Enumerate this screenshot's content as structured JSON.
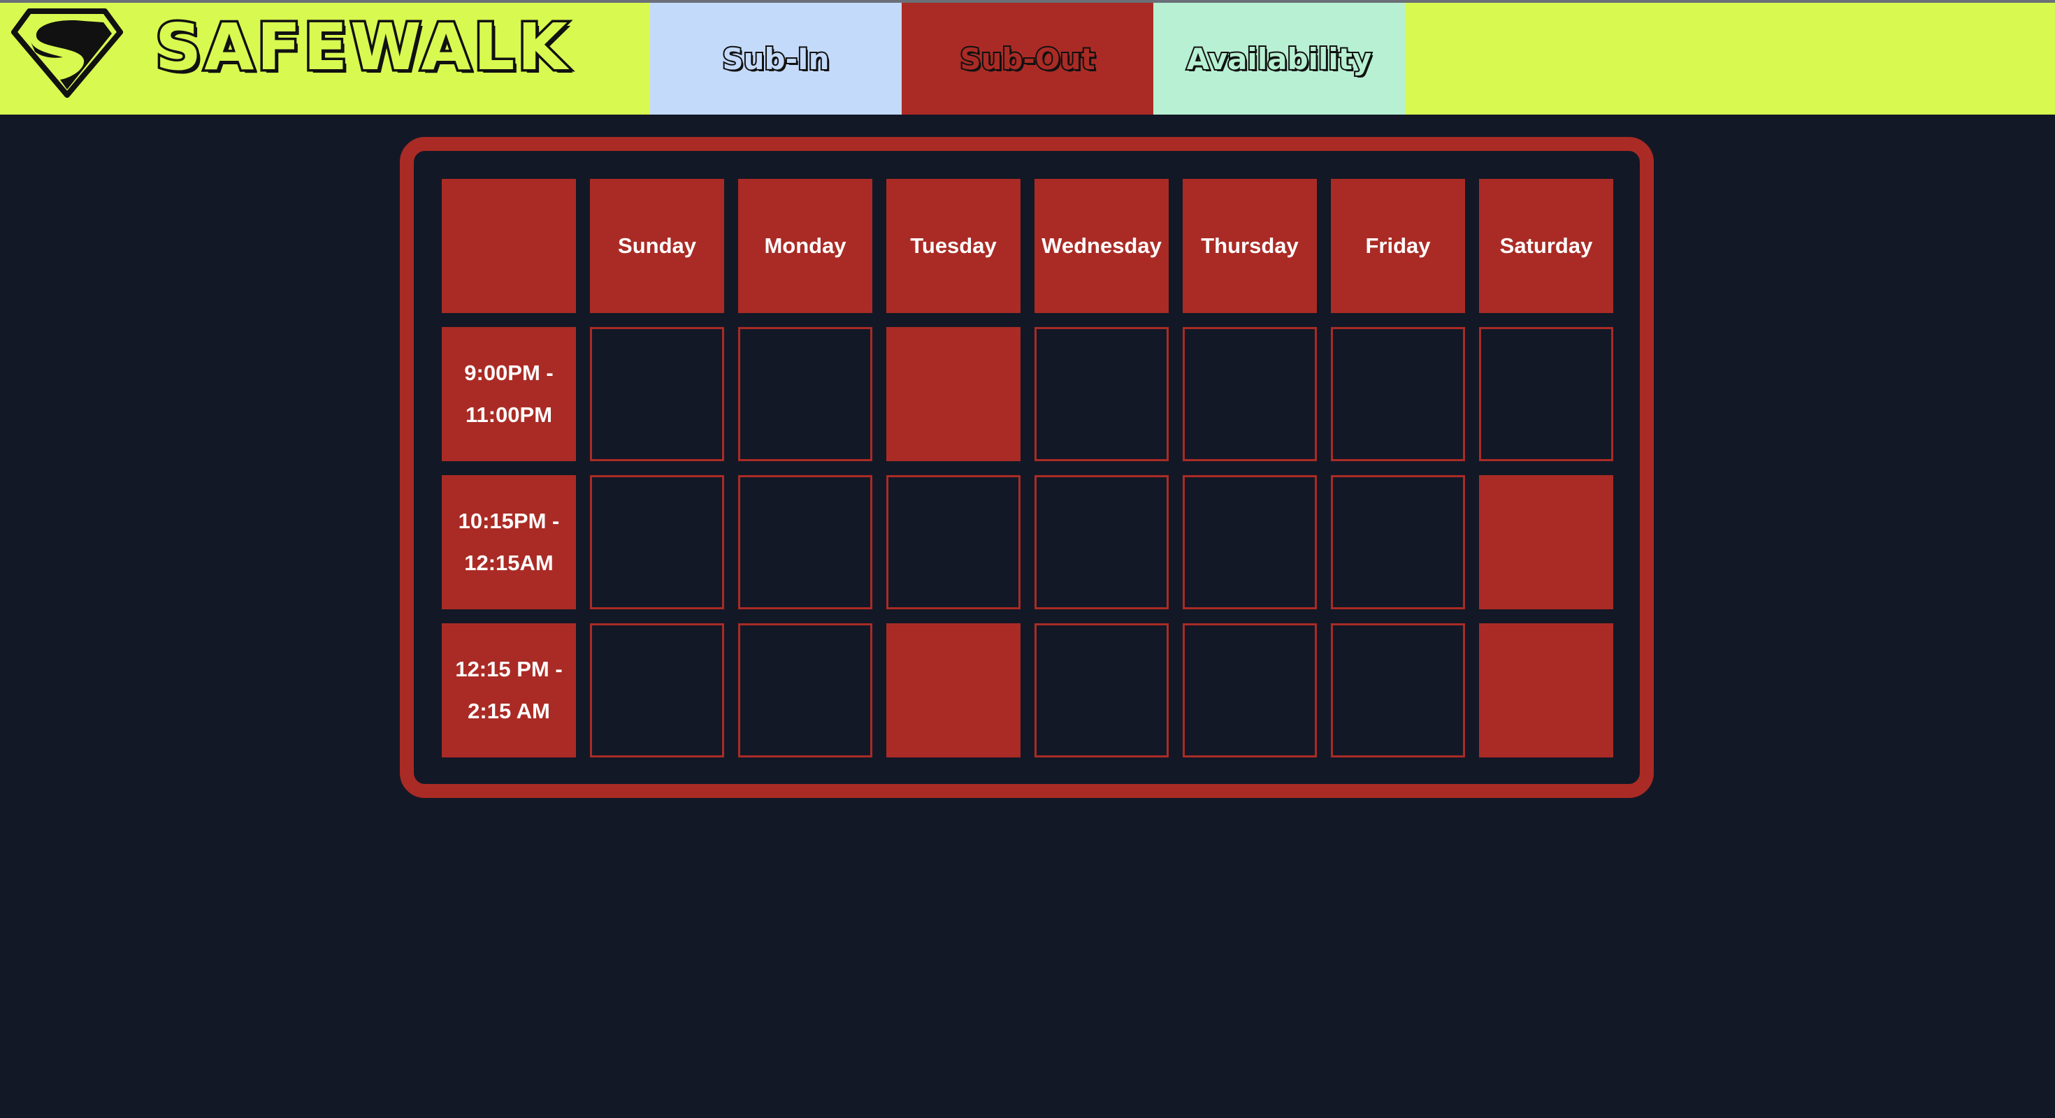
{
  "brand": {
    "logo_icon": "superman-shield-icon",
    "name": "SAFEWALK"
  },
  "nav": {
    "tabs": [
      {
        "label": "Sub-In",
        "color": "#c4dafb"
      },
      {
        "label": "Sub-Out",
        "color": "#aa2b25"
      },
      {
        "label": "Availability",
        "color": "#b7f0d2"
      }
    ]
  },
  "colors": {
    "navbar_bg": "#d8fa50",
    "page_bg": "#131826",
    "accent_red": "#aa2b25"
  },
  "schedule": {
    "corner_label": "",
    "days": [
      "Sunday",
      "Monday",
      "Tuesday",
      "Wednesday",
      "Thursday",
      "Friday",
      "Saturday"
    ],
    "shifts": [
      {
        "time_start": "9:00PM -",
        "time_end": "11:00PM",
        "filled": [
          false,
          false,
          true,
          false,
          false,
          false,
          false
        ]
      },
      {
        "time_start": "10:15PM -",
        "time_end": "12:15AM",
        "filled": [
          false,
          false,
          false,
          false,
          false,
          false,
          true
        ]
      },
      {
        "time_start": "12:15 PM -",
        "time_end": "2:15 AM",
        "filled": [
          false,
          false,
          true,
          false,
          false,
          false,
          true
        ]
      }
    ]
  }
}
